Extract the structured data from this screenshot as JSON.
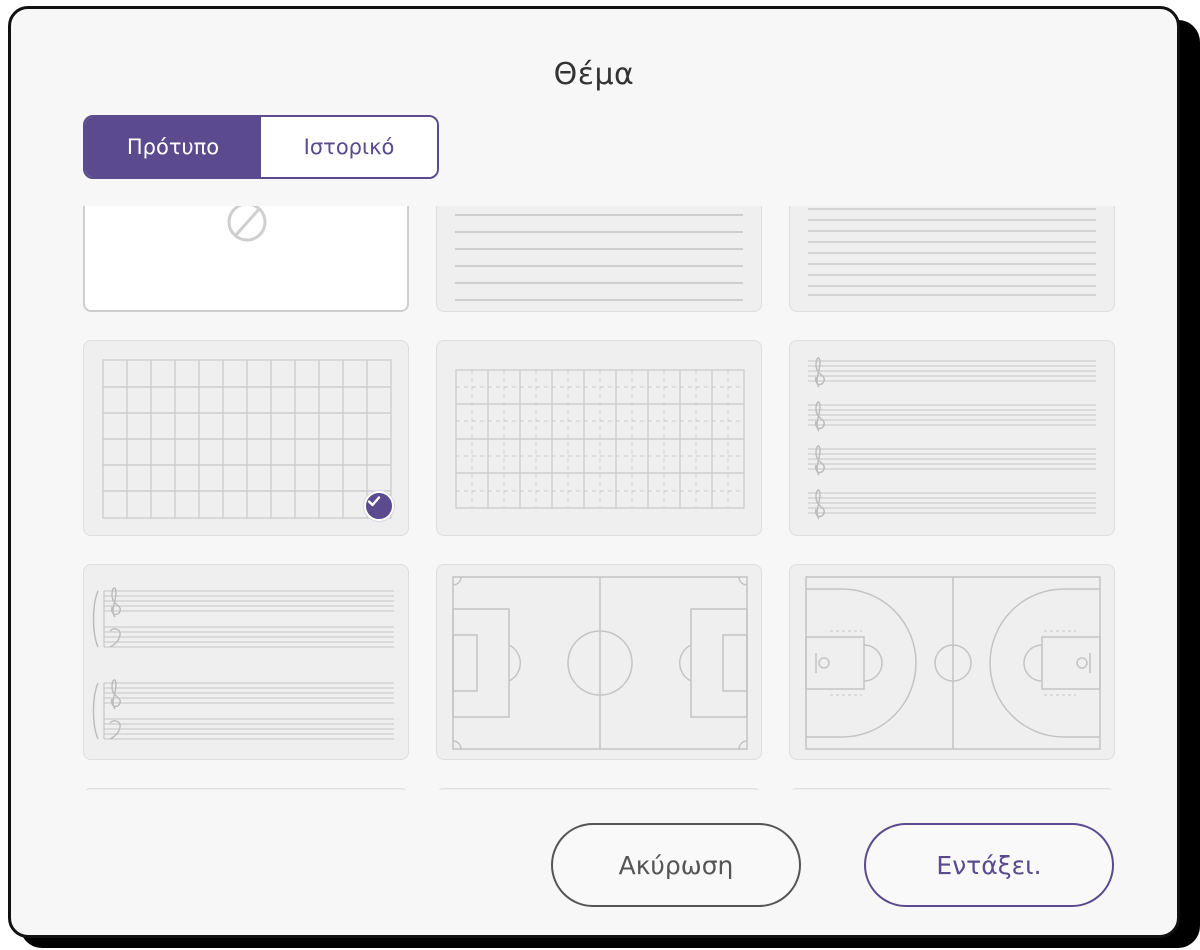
{
  "dialog": {
    "title": "Θέμα",
    "tabs": [
      {
        "label": "Πρότυπο",
        "active": true
      },
      {
        "label": "Ιστορικό",
        "active": false
      }
    ],
    "buttons": {
      "cancel": "Ακύρωση",
      "ok": "Εντάξει."
    }
  },
  "templates": [
    {
      "kind": "none",
      "icon": "none-icon"
    },
    {
      "kind": "ruled-lines"
    },
    {
      "kind": "narrow-ruled-lines"
    },
    {
      "kind": "square-grid",
      "selected": true
    },
    {
      "kind": "dotted-grid"
    },
    {
      "kind": "music-staff"
    },
    {
      "kind": "piano-staff"
    },
    {
      "kind": "football-pitch"
    },
    {
      "kind": "basketball-court"
    }
  ],
  "colors": {
    "accent": "#5b4a8e",
    "line": "#c8c8c8"
  }
}
